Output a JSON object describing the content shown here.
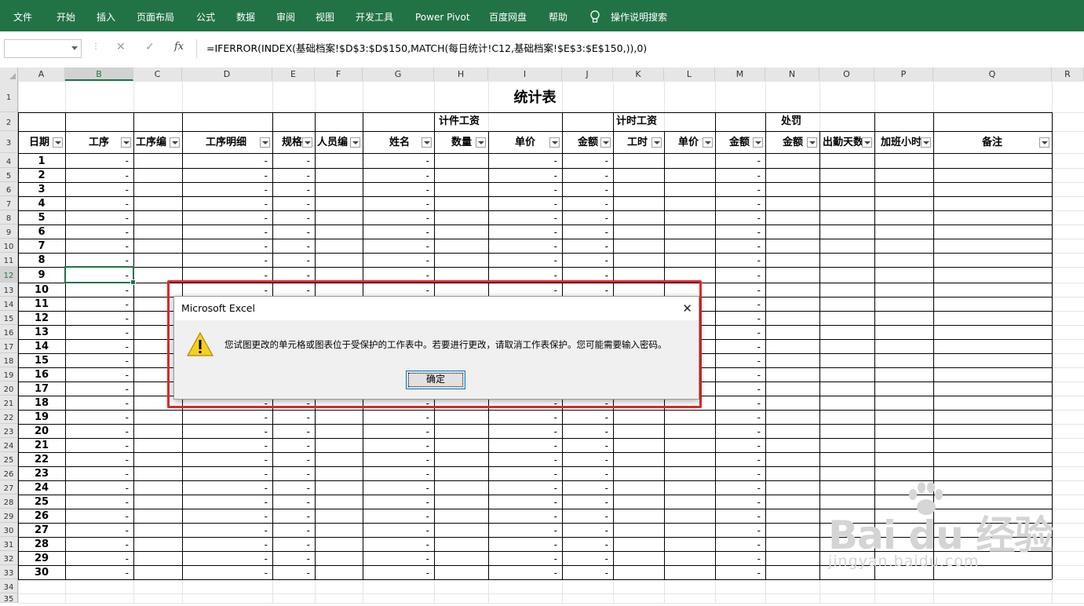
{
  "ribbon": {
    "menu": [
      "文件",
      "开始",
      "插入",
      "页面布局",
      "公式",
      "数据",
      "审阅",
      "视图",
      "开发工具",
      "Power Pivot",
      "百度网盘",
      "帮助"
    ],
    "search_label": "操作说明搜索",
    "accent": "#217346"
  },
  "formula_bar": {
    "name_box": "",
    "cancel_symbol": "✕",
    "enter_symbol": "✓",
    "fx_symbol": "fx",
    "formula": "=IFERROR(INDEX(基础档案!$D$3:$D$150,MATCH(每日统计!C12,基础档案!$E$3:$E$150,)),0)"
  },
  "columns": [
    "A",
    "B",
    "C",
    "D",
    "E",
    "F",
    "G",
    "H",
    "I",
    "J",
    "K",
    "L",
    "M",
    "N",
    "O",
    "P",
    "Q",
    "R"
  ],
  "selected_column": "B",
  "selected_row": 12,
  "sheet": {
    "title": "统计表",
    "group_headers": {
      "piece_wage": "计件工资",
      "time_wage": "计时工资",
      "penalty": "处罚"
    },
    "headers": [
      "日期",
      "工序",
      "工序编",
      "工序明细",
      "规格",
      "人员编",
      "姓名",
      "数量",
      "单价",
      "金额",
      "工时",
      "单价",
      "金额",
      "金额",
      "出勤天数",
      "加班小时",
      "备注"
    ],
    "placeholder": "-",
    "rows": [
      1,
      2,
      3,
      4,
      5,
      6,
      7,
      8,
      9,
      10,
      11,
      12,
      13,
      14,
      15,
      16,
      17,
      18,
      19,
      20,
      21,
      22,
      23,
      24,
      25,
      26,
      27,
      28,
      29,
      30
    ]
  },
  "dialog": {
    "title": "Microsoft Excel",
    "close_symbol": "✕",
    "message": "您试图更改的单元格或图表位于受保护的工作表中。若要进行更改，请取消工作表保护。您可能需要输入密码。",
    "ok_label": "确定",
    "highlight_color": "#e0282a"
  },
  "watermark": {
    "brand": "Bai du 经验",
    "url": "jingyan.baidu.com"
  }
}
